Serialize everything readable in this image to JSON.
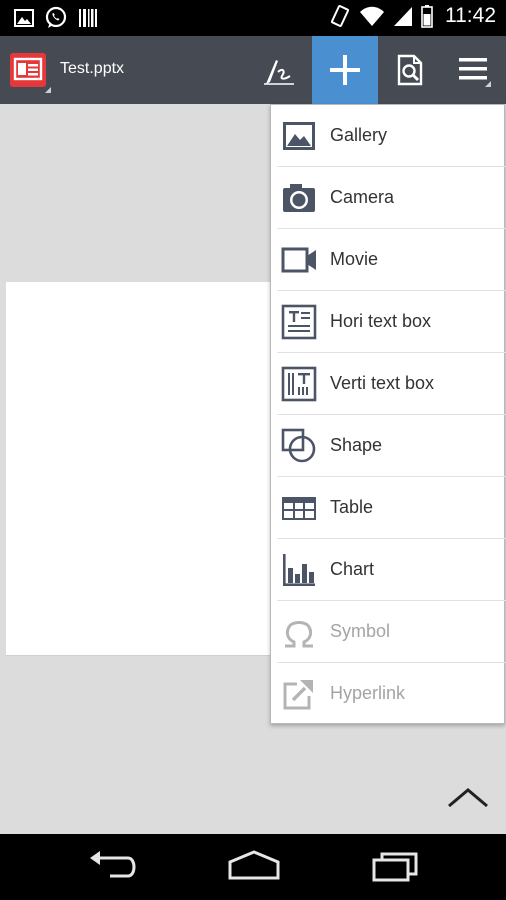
{
  "document": {
    "title": "Test.pptx"
  },
  "status_bar": {
    "time": "11:42"
  },
  "toolbar": {
    "pen_icon": "pen-icon",
    "add_icon": "plus-icon",
    "preview_icon": "preview-icon",
    "menu_icon": "menu-icon",
    "active_color": "#4a90d0"
  },
  "insert_menu": {
    "items": [
      {
        "label": "Gallery",
        "icon": "gallery-icon",
        "enabled": true
      },
      {
        "label": "Camera",
        "icon": "camera-icon",
        "enabled": true
      },
      {
        "label": "Movie",
        "icon": "movie-icon",
        "enabled": true
      },
      {
        "label": "Hori text box",
        "icon": "horizontal-text-box-icon",
        "enabled": true
      },
      {
        "label": "Verti text box",
        "icon": "vertical-text-box-icon",
        "enabled": true
      },
      {
        "label": "Shape",
        "icon": "shape-icon",
        "enabled": true
      },
      {
        "label": "Table",
        "icon": "table-icon",
        "enabled": true
      },
      {
        "label": "Chart",
        "icon": "chart-icon",
        "enabled": true
      },
      {
        "label": "Symbol",
        "icon": "omega-icon",
        "enabled": false
      },
      {
        "label": "Hyperlink",
        "icon": "hyperlink-icon",
        "enabled": false
      }
    ]
  }
}
